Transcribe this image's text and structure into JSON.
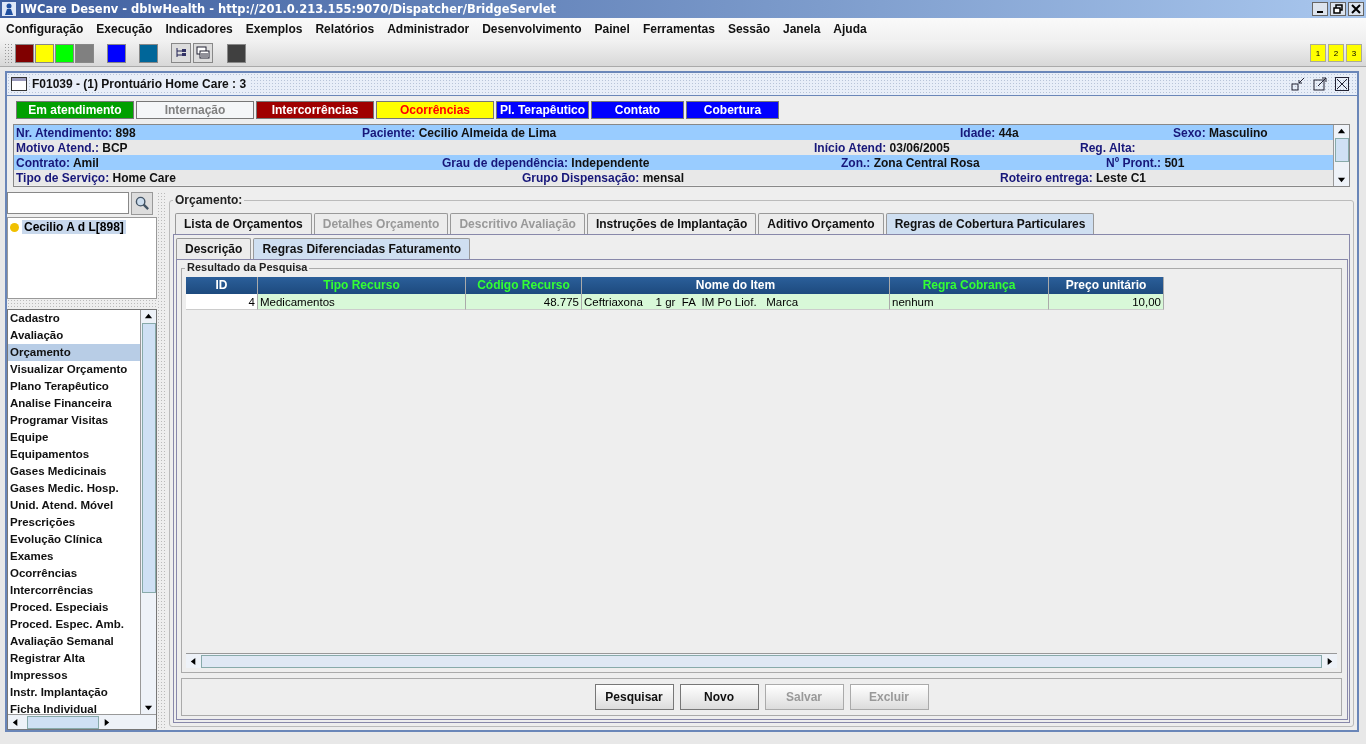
{
  "window": {
    "title": "IWCare Desenv - dbIwHealth - http://201.0.213.155:9070/Dispatcher/BridgeServlet"
  },
  "menu": [
    "Configuração",
    "Execução",
    "Indicadores",
    "Exemplos",
    "Relatórios",
    "Administrador",
    "Desenvolvimento",
    "Painel",
    "Ferramentas",
    "Sessão",
    "Janela",
    "Ajuda"
  ],
  "toolbar": {
    "color_buttons": [
      {
        "color": "#800000"
      },
      {
        "color": "#ffff00"
      },
      {
        "color": "#00ff00"
      },
      {
        "color": "#808080"
      },
      {
        "color": "#0000ff"
      },
      {
        "color": "#006699"
      }
    ],
    "page_buttons": [
      "1",
      "2",
      "3"
    ]
  },
  "frame": {
    "title": "F01039 - (1) Prontuário Home Care : 3"
  },
  "status_buttons": [
    {
      "label": "Em atendimento",
      "color": "#00a000",
      "kind": "normal"
    },
    {
      "label": "Internação",
      "color": "#f4f6f8",
      "kind": "inactive"
    },
    {
      "label": "Intercorrências",
      "color": "#a00000",
      "kind": "normal"
    },
    {
      "label": "Ocorrências",
      "color": "#ffff00",
      "kind": "alert"
    },
    {
      "label": "Pl. Terapêutico",
      "color": "#0000ff",
      "kind": "normal"
    },
    {
      "label": "Contato",
      "color": "#0000ff",
      "kind": "normal"
    },
    {
      "label": "Cobertura",
      "color": "#0000ff",
      "kind": "normal"
    }
  ],
  "patient_info": [
    [
      {
        "label": "Nr. Atendimento:",
        "value": "898"
      },
      {
        "label": "Paciente:",
        "value": "Cecilio Almeida de Lima"
      },
      {
        "label": "Idade:",
        "value": "44a"
      },
      {
        "label": "Sexo:",
        "value": "Masculino"
      }
    ],
    [
      {
        "label": "Motivo Atend.:",
        "value": "BCP"
      },
      {
        "label": "Início Atend:",
        "value": "03/06/2005"
      },
      {
        "label": "Reg. Alta:"
      }
    ],
    [
      {
        "label": "Contrato:",
        "value": "Amil"
      },
      {
        "label": "Grau de dependência:",
        "value": "Independente"
      },
      {
        "label": "Zon.:",
        "value": "Zona Central Rosa"
      },
      {
        "label": "Nº Pront.:",
        "value": "501"
      }
    ],
    [
      {
        "label": "Tipo de Serviço:",
        "value": "Home Care"
      },
      {
        "label": "Grupo Dispensação:",
        "value": "mensal"
      },
      {
        "label": "Roteiro entrega:",
        "value": "Leste C1"
      }
    ]
  ],
  "tree": [
    {
      "label": "Cecilio A d L[898]",
      "selected": true
    }
  ],
  "sidebar": {
    "items": [
      {
        "label": "Cadastro",
        "selected": false
      },
      {
        "label": "Avaliação",
        "selected": false
      },
      {
        "label": "Orçamento",
        "selected": true
      },
      {
        "label": "Visualizar Orçamento",
        "selected": false
      },
      {
        "label": "Plano Terapêutico",
        "selected": false
      },
      {
        "label": "Analise Financeira",
        "selected": false
      },
      {
        "label": "Programar Visitas",
        "selected": false
      },
      {
        "label": "Equipe",
        "selected": false
      },
      {
        "label": "Equipamentos",
        "selected": false
      },
      {
        "label": "Gases Medicinais",
        "selected": false
      },
      {
        "label": "Gases Medic. Hosp.",
        "selected": false
      },
      {
        "label": "Unid. Atend. Móvel",
        "selected": false
      },
      {
        "label": "Prescrições",
        "selected": false
      },
      {
        "label": "Evolução Clínica",
        "selected": false
      },
      {
        "label": "Exames",
        "selected": false
      },
      {
        "label": "Ocorrências",
        "selected": false
      },
      {
        "label": "Intercorrências",
        "selected": false
      },
      {
        "label": "Proced. Especiais",
        "selected": false
      },
      {
        "label": "Proced. Espec. Amb.",
        "selected": false
      },
      {
        "label": "Avaliação Semanal",
        "selected": false
      },
      {
        "label": "Registrar Alta",
        "selected": false
      },
      {
        "label": "Impressos",
        "selected": false
      },
      {
        "label": "Instr. Implantação",
        "selected": false
      },
      {
        "label": "Ficha Individual",
        "selected": false
      }
    ]
  },
  "section_title": "Orçamento:",
  "tabs": [
    {
      "label": "Lista de Orçamentos",
      "selected": false,
      "disabled": false
    },
    {
      "label": "Detalhes Orçamento",
      "selected": false,
      "disabled": true
    },
    {
      "label": "Descritivo Avaliação",
      "selected": false,
      "disabled": true
    },
    {
      "label": "Instruções de Implantação",
      "selected": false,
      "disabled": false
    },
    {
      "label": "Aditivo Orçamento",
      "selected": false,
      "disabled": false
    },
    {
      "label": "Regras de Cobertura Particulares",
      "selected": true,
      "disabled": false
    }
  ],
  "subtabs": [
    {
      "label": "Descrição",
      "selected": false
    },
    {
      "label": "Regras Diferenciadas Faturamento",
      "selected": true
    }
  ],
  "results_title": "Resultado da Pesquisa",
  "table": {
    "columns": [
      {
        "name": "ID",
        "required": false,
        "kind": "number"
      },
      {
        "name": "Tipo Recurso",
        "required": true,
        "kind": "text"
      },
      {
        "name": "Código Recurso",
        "required": true,
        "kind": "number"
      },
      {
        "name": "Nome do Item",
        "required": false,
        "kind": "text"
      },
      {
        "name": "Regra Cobrança",
        "required": true,
        "kind": "text"
      },
      {
        "name": "Preço unitário",
        "required": false,
        "kind": "number"
      }
    ],
    "rows": [
      [
        "4",
        "Medicamentos",
        "48.775",
        "Ceftriaxona    1 gr  FA  IM Po Liof.   Marca",
        "nenhum",
        "10,00"
      ]
    ]
  },
  "buttons": [
    {
      "label": "Pesquisar",
      "disabled": false
    },
    {
      "label": "Novo",
      "disabled": false
    },
    {
      "label": "Salvar",
      "disabled": true
    },
    {
      "label": "Excluir",
      "disabled": true
    }
  ]
}
